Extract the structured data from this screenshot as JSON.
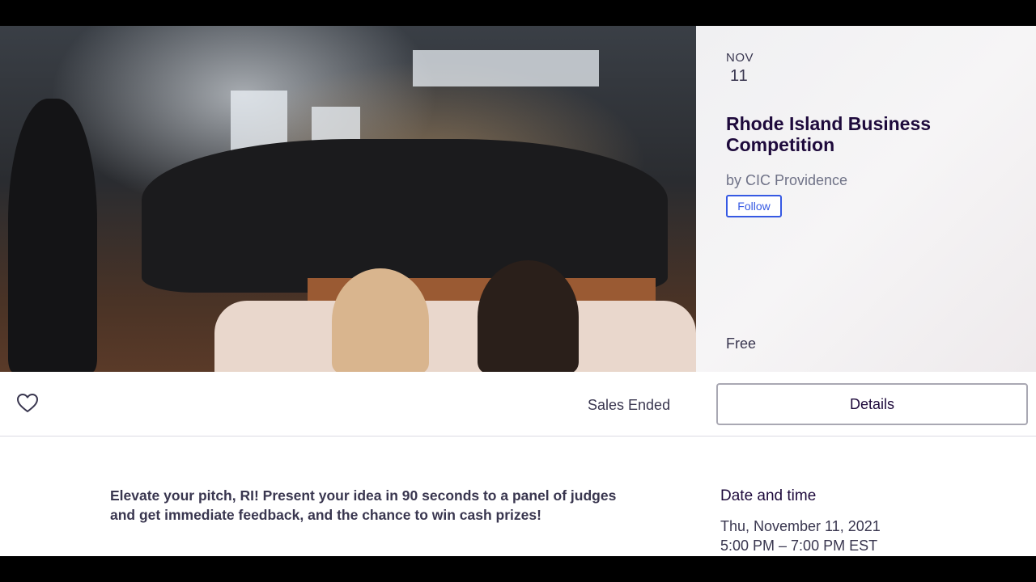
{
  "event": {
    "month": "NOV",
    "day": "11",
    "title": "Rhode Island Business Competition",
    "organizer": "by CIC Providence",
    "follow_label": "Follow",
    "price": "Free"
  },
  "action_bar": {
    "like_icon": "heart-outline-icon",
    "sales_status": "Sales Ended",
    "details_label": "Details"
  },
  "description": {
    "summary": "Elevate your pitch, RI! Present your idea in 90 seconds to a panel of judges and get immediate feedback, and the chance to win cash prizes!"
  },
  "date_time": {
    "heading": "Date and time",
    "date": "Thu, November 11, 2021",
    "time": "5:00 PM – 7:00 PM EST"
  },
  "colors": {
    "accent_blue": "#3659e3",
    "title_text": "#1e0a3c",
    "body_text": "#39364f",
    "muted_text": "#6f7287"
  }
}
